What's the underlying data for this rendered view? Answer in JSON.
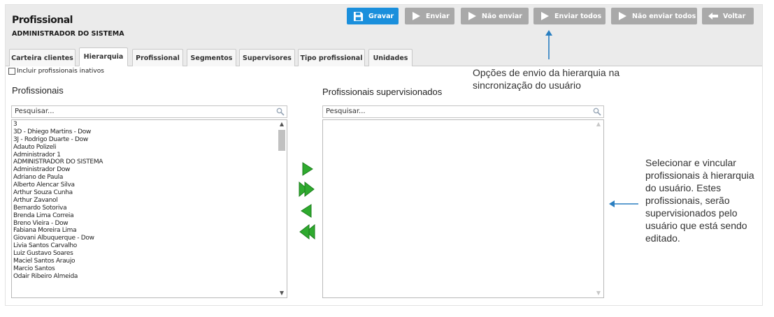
{
  "header": {
    "title": "Profissional",
    "subtitle": "ADMINISTRADOR DO SISTEMA"
  },
  "toolbar": {
    "save_label": "Gravar",
    "send_label": "Enviar",
    "not_send_label": "Não enviar",
    "send_all_label": "Enviar todos",
    "not_send_all_label": "Não enviar todos",
    "back_label": "Voltar"
  },
  "tabs": [
    {
      "label": "Carteira clientes",
      "active": false
    },
    {
      "label": "Hierarquia",
      "active": true
    },
    {
      "label": "Profissional",
      "active": false
    },
    {
      "label": "Segmentos",
      "active": false
    },
    {
      "label": "Supervisores",
      "active": false
    },
    {
      "label": "Tipo profissional",
      "active": false
    },
    {
      "label": "Unidades",
      "active": false
    }
  ],
  "include_inactive": {
    "label": "Incluir profissionais inativos",
    "checked": false
  },
  "left_panel": {
    "title": "Profissionais",
    "search_placeholder": "Pesquisar...",
    "items": [
      "3",
      "3D - Dhiego Martins - Dow",
      "3J - Rodrigo Duarte - Dow",
      "Adauto Polizeli",
      "Administrador 1",
      "ADMINISTRADOR DO SISTEMA",
      "Administrador Dow",
      "Adriano de Paula",
      "Alberto Alencar Silva",
      "Arthur Souza Cunha",
      "Arthur Zavanol",
      "Bernardo Sotoriva",
      "Brenda Lima Correia",
      "Breno Vieira - Dow",
      "Fabiana Moreira Lima",
      "Giovani Albuquerque - Dow",
      "Livia Santos Carvalho",
      "Luiz Gustavo Soares",
      "Maciel Santos Araujo",
      "Marcio Santos",
      "Odair Ribeiro Almeida"
    ]
  },
  "right_panel": {
    "title": "Profissionais supervisionados",
    "search_placeholder": "Pesquisar...",
    "items": []
  },
  "annotations": {
    "top": "Opções de envio da hierarquia na sincronização do usuário",
    "right": "Selecionar e vincular profissionais à hierarquia do usuário. Estes profissionais, serão supervisionados pelo usuário que está sendo editado."
  },
  "icons": {
    "save": "floppy-disk-icon",
    "send": "play-icon",
    "back": "arrow-left-icon",
    "search": "magnifier-icon",
    "move_one": "arrow-right-green-icon",
    "move_all": "double-arrow-right-green-icon",
    "remove_one": "arrow-left-green-icon",
    "remove_all": "double-arrow-left-green-icon"
  },
  "colors": {
    "primary_button": "#1a8fdc",
    "secondary_button": "#a9a9a9",
    "arrow_green": "#2eaa2e",
    "annotation_arrow": "#2a7fc1"
  }
}
